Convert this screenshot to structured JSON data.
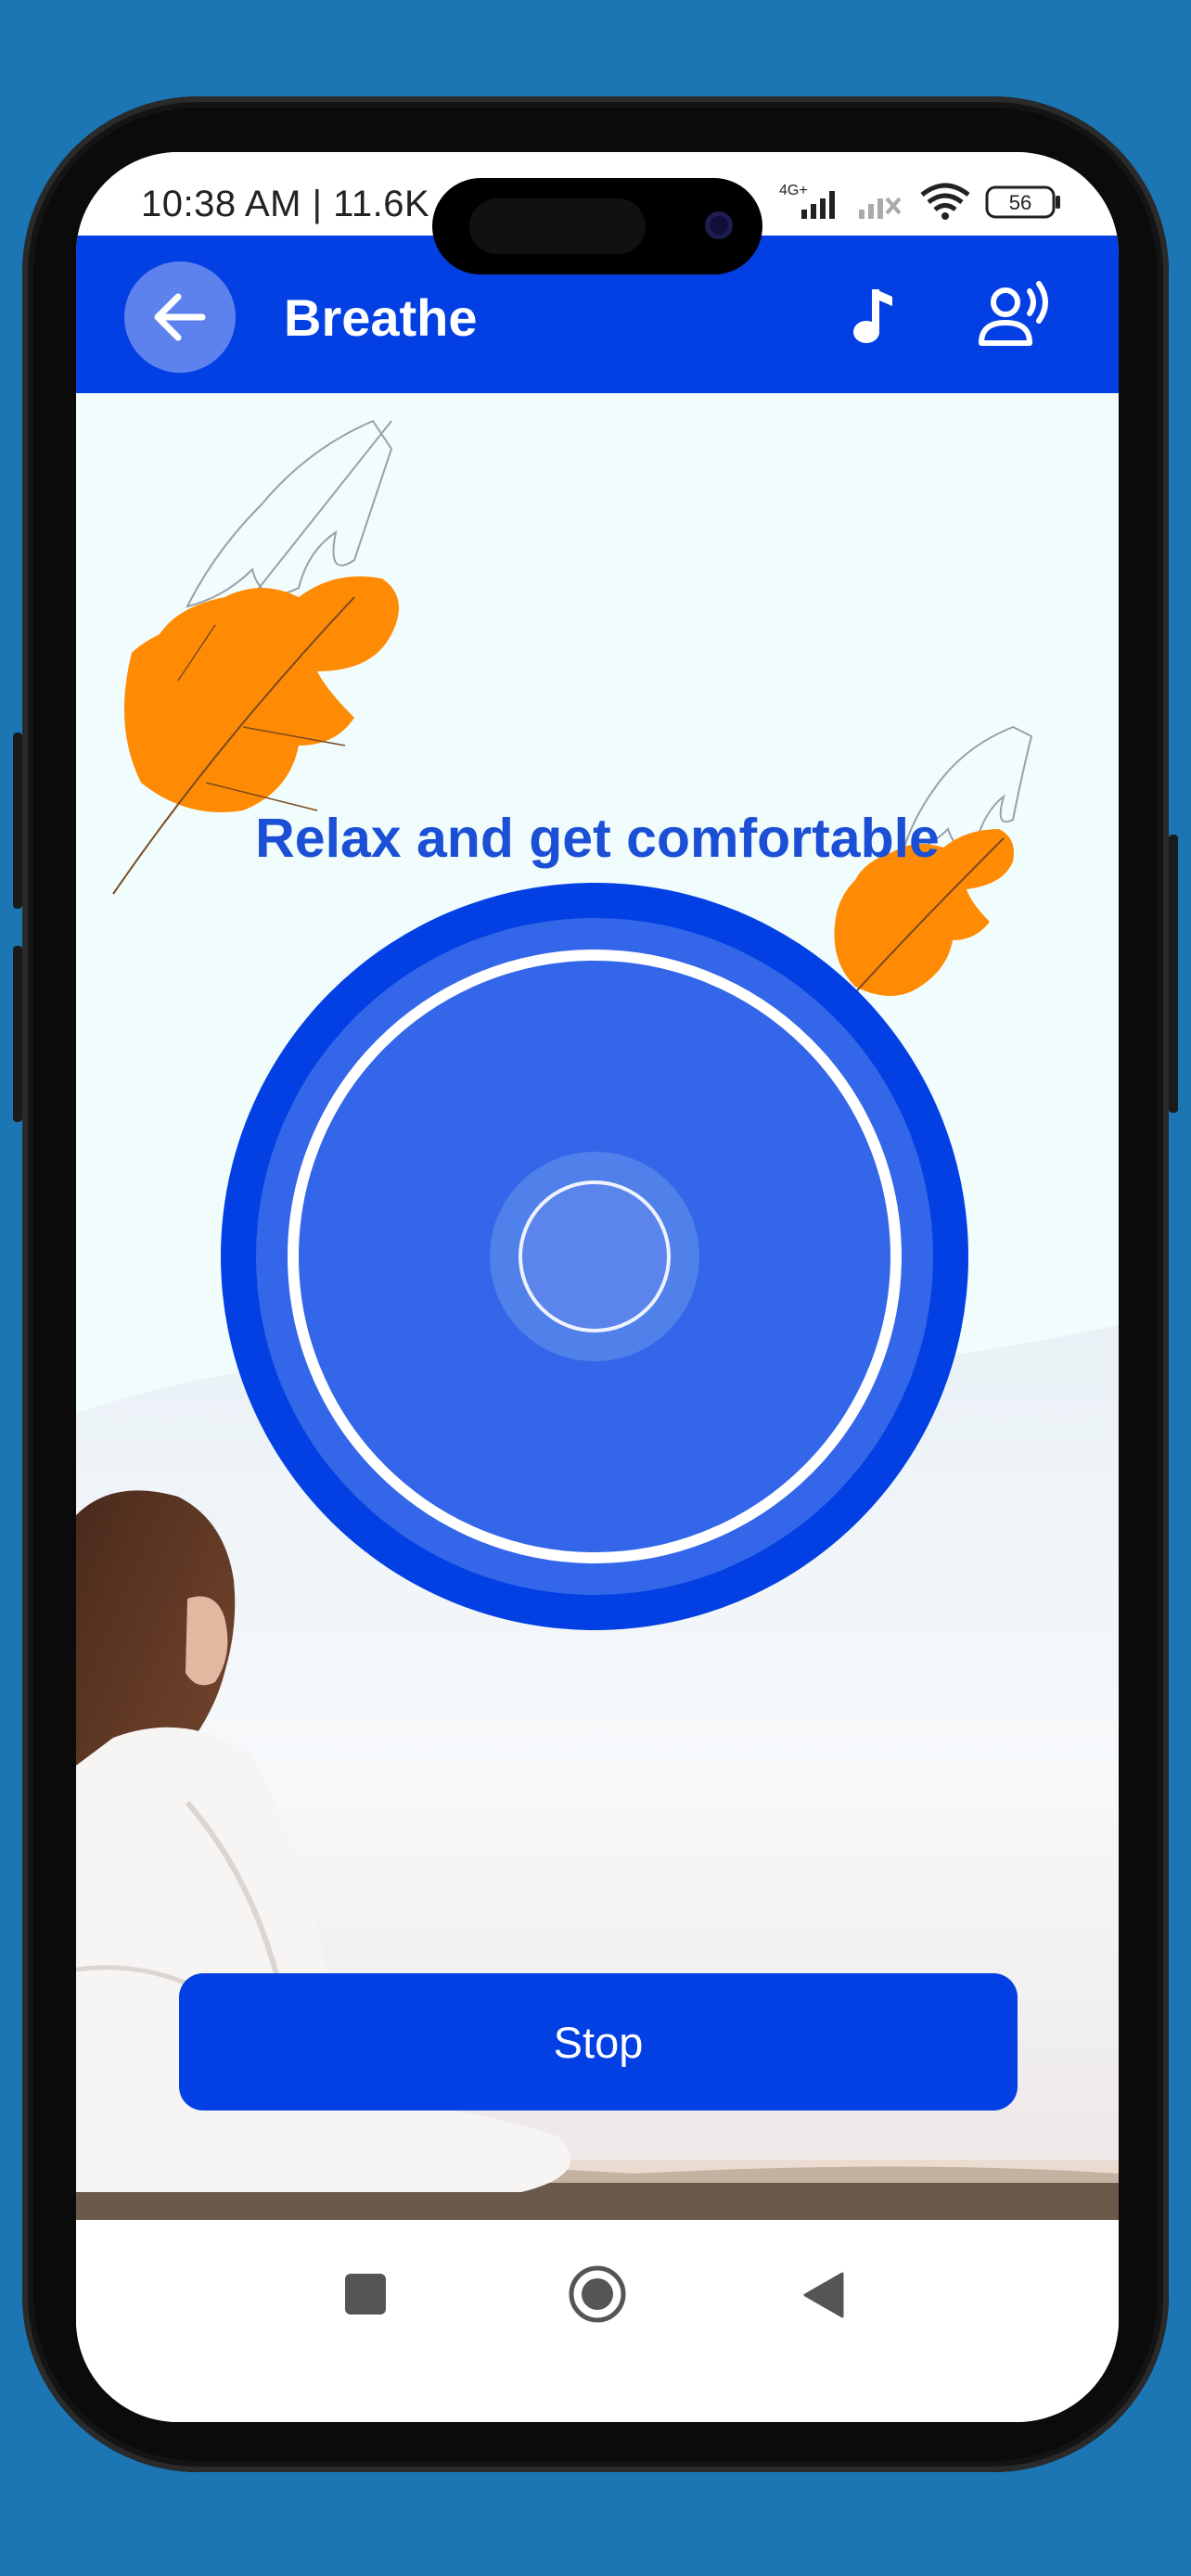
{
  "status_bar": {
    "time": "10:38 AM | 11.6K",
    "network": "4G+",
    "battery": "56"
  },
  "app_bar": {
    "title": "Breathe"
  },
  "main": {
    "instruction": "Relax and get comfortable",
    "stop_label": "Stop"
  },
  "icons": {
    "back": "arrow-left",
    "music": "music-note",
    "voice": "speaking-person",
    "nav_recents": "square",
    "nav_home": "circle",
    "nav_back": "triangle-left"
  },
  "colors": {
    "brand_blue": "#0340e3",
    "headline_blue": "#1b4fd6",
    "circle_inner": "#3366e8",
    "leaf_orange": "#ff8b04",
    "background": "#1c76b4"
  }
}
